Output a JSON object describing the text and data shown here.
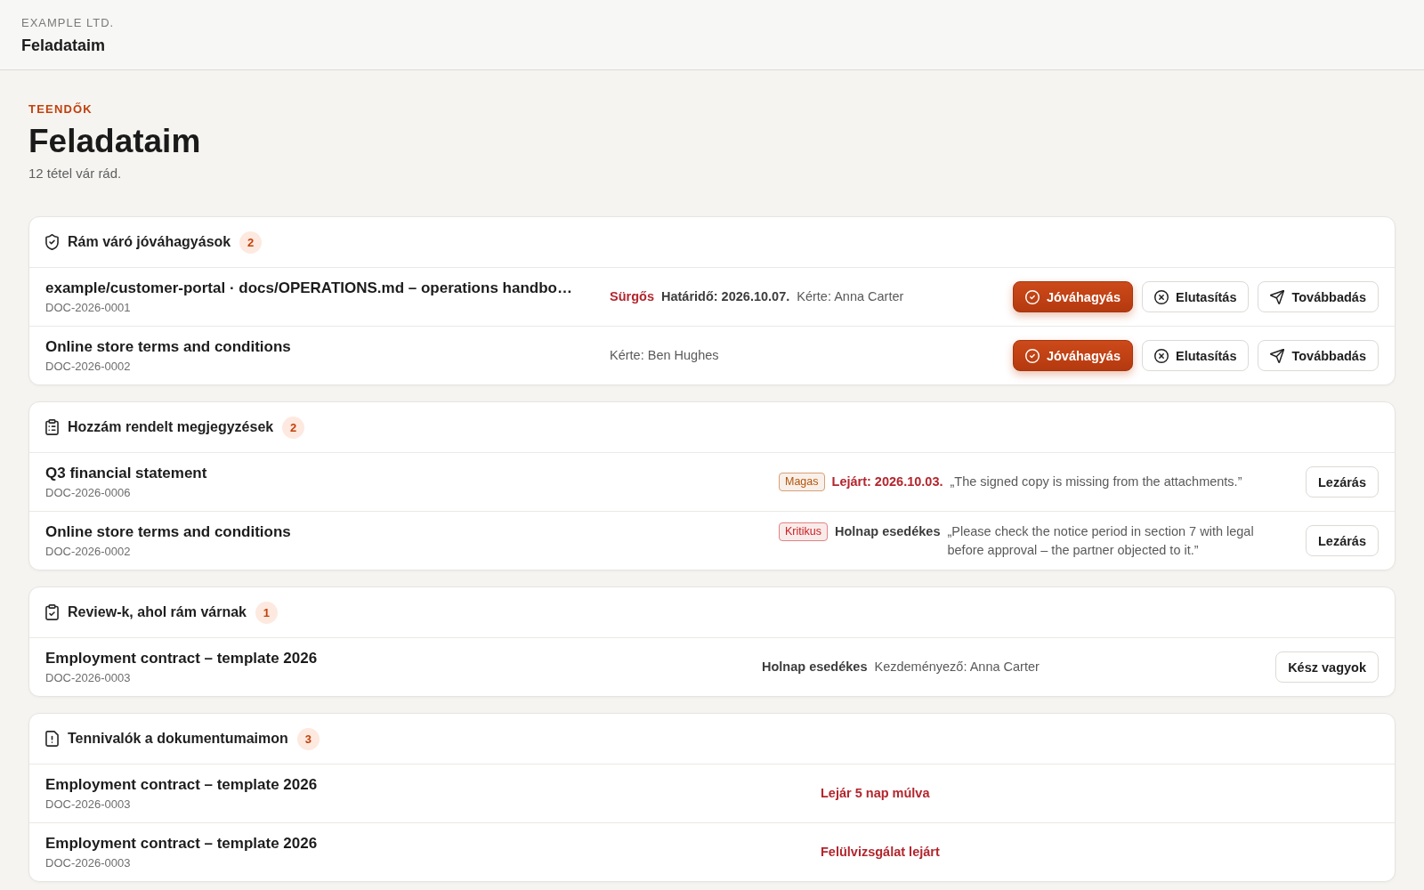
{
  "header": {
    "company": "EXAMPLE LTD.",
    "title": "Feladataim"
  },
  "page": {
    "eyebrow": "TEENDŐK",
    "title": "Feladataim",
    "subtitle": "12 tétel vár rád."
  },
  "sections": [
    {
      "kind": "approvals",
      "title": "Rám váró jóváhagyások",
      "count": "2",
      "rows": [
        {
          "title": "example/customer-portal · docs/OPERATIONS.md – operations handbo…",
          "id": "DOC-2026-0001",
          "urgency": "Sürgős",
          "due": "Határidő: 2026.10.07.",
          "overdue": false,
          "requester": "Kérte: Anna Carter",
          "buttons": [
            {
              "kind": "approve",
              "label": "Jóváhagyás"
            },
            {
              "kind": "reject",
              "label": "Elutasítás"
            },
            {
              "kind": "forward",
              "label": "Továbbadás"
            }
          ]
        },
        {
          "title": "Online store terms and conditions",
          "id": "DOC-2026-0002",
          "requester": "Kérte: Ben Hughes",
          "buttons": [
            {
              "kind": "approve",
              "label": "Jóváhagyás"
            },
            {
              "kind": "reject",
              "label": "Elutasítás"
            },
            {
              "kind": "forward",
              "label": "Továbbadás"
            }
          ]
        }
      ]
    },
    {
      "kind": "comments",
      "title": "Hozzám rendelt megjegyzések",
      "count": "2",
      "rows": [
        {
          "title": "Q3 financial statement",
          "id": "DOC-2026-0006",
          "priority": {
            "label": "Magas",
            "color": "#b45309"
          },
          "due": "Lejárt: 2026.10.03.",
          "overdue": true,
          "note": "„The signed copy is missing from the attachments.”",
          "buttons": [
            {
              "kind": "plain",
              "label": "Lezárás"
            }
          ]
        },
        {
          "title": "Online store terms and conditions",
          "id": "DOC-2026-0002",
          "priority": {
            "label": "Kritikus",
            "color": "#c81e1e"
          },
          "due": "Holnap esedékes",
          "overdue": false,
          "note": "„Please check the notice period in section 7 with legal before approval – the partner objected to it.”",
          "buttons": [
            {
              "kind": "plain",
              "label": "Lezárás"
            }
          ]
        }
      ]
    },
    {
      "kind": "reviews",
      "title": "Review-k, ahol rám várnak",
      "count": "1",
      "rows": [
        {
          "title": "Employment contract – template 2026",
          "id": "DOC-2026-0003",
          "due": "Holnap esedékes",
          "overdue": false,
          "requester": "Kezdeményező: Anna Carter",
          "buttons": [
            {
              "kind": "plain",
              "label": "Kész vagyok"
            }
          ]
        }
      ]
    },
    {
      "kind": "tasks",
      "title": "Tennivalók a dokumentumaimon",
      "count": "3",
      "rows": [
        {
          "title": "Employment contract – template 2026",
          "id": "DOC-2026-0003",
          "status": "Lejár 5 nap múlva"
        },
        {
          "title": "Employment contract – template 2026",
          "id": "DOC-2026-0003",
          "status": "Felülvizsgálat lejárt"
        }
      ]
    }
  ]
}
